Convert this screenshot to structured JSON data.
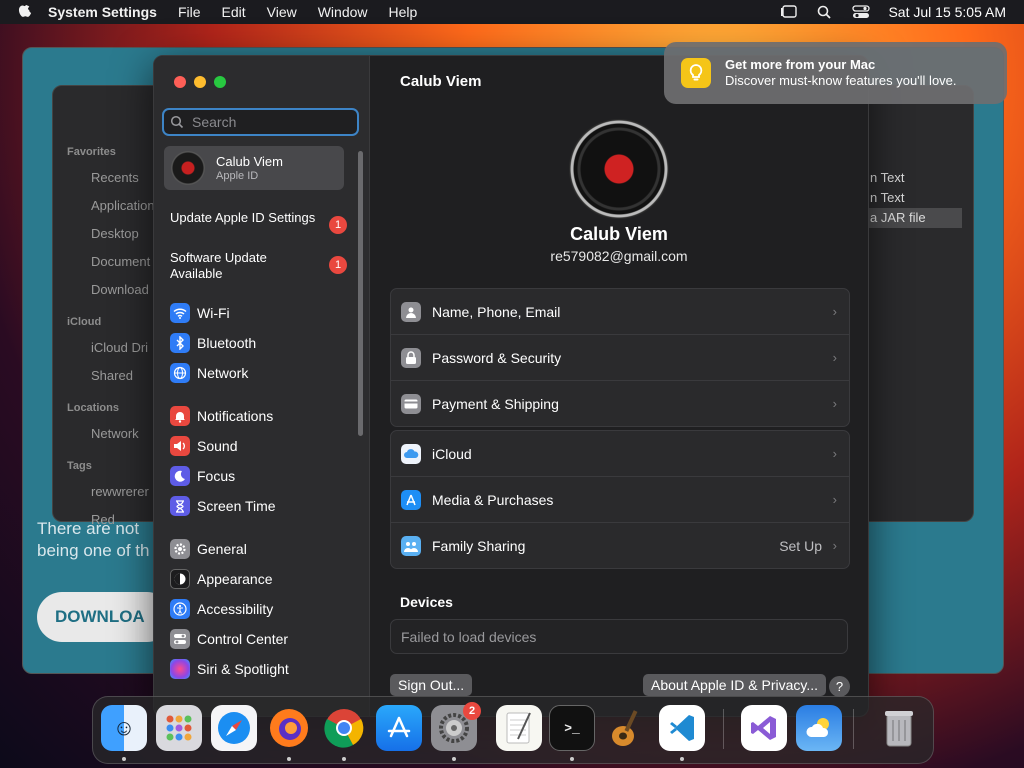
{
  "menubar": {
    "app": "System Settings",
    "menus": [
      "File",
      "Edit",
      "View",
      "Window",
      "Help"
    ],
    "clock": "Sat Jul 15  5:05 AM"
  },
  "background": {
    "finder_sidebar": [
      "Favorites",
      "Recents",
      "Application",
      "Desktop",
      "Document",
      "Download",
      "iCloud",
      "iCloud Dri",
      "Shared",
      "Locations",
      "Network",
      "Tags",
      "rewwrerer",
      "Red"
    ],
    "finder_rows": [
      "n Text",
      "n Text",
      "a JAR file"
    ],
    "web_text_1": "There are not",
    "web_text_2": "being one of th",
    "web_button": "DOWNLOA"
  },
  "settings": {
    "search_placeholder": "Search",
    "account": {
      "name": "Calub Viem",
      "sub": "Apple ID"
    },
    "notices": [
      {
        "label": "Update Apple ID Settings",
        "badge": "1"
      },
      {
        "label": "Software Update Available",
        "badge": "1"
      }
    ],
    "nav": [
      {
        "label": "Wi-Fi",
        "icon": "wifi-icon",
        "color": "#2f7cf6"
      },
      {
        "label": "Bluetooth",
        "icon": "bluetooth-icon",
        "color": "#2f7cf6"
      },
      {
        "label": "Network",
        "icon": "globe-icon",
        "color": "#2f7cf6"
      },
      {
        "label": "Notifications",
        "icon": "bell-icon",
        "color": "#e9483f"
      },
      {
        "label": "Sound",
        "icon": "speaker-icon",
        "color": "#e9483f"
      },
      {
        "label": "Focus",
        "icon": "moon-icon",
        "color": "#5e5ce6"
      },
      {
        "label": "Screen Time",
        "icon": "hourglass-icon",
        "color": "#5e5ce6"
      },
      {
        "label": "General",
        "icon": "gear-icon",
        "color": "#8e8e93"
      },
      {
        "label": "Appearance",
        "icon": "appearance-icon",
        "color": "#1c1c1e"
      },
      {
        "label": "Accessibility",
        "icon": "accessibility-icon",
        "color": "#2f7cf6"
      },
      {
        "label": "Control Center",
        "icon": "switches-icon",
        "color": "#8e8e93"
      },
      {
        "label": "Siri & Spotlight",
        "icon": "siri-icon",
        "color": "#b84fd8"
      }
    ],
    "main": {
      "title": "Calub Viem",
      "name": "Calub Viem",
      "email": "re579082@gmail.com",
      "group1": [
        {
          "label": "Name, Phone, Email",
          "icon": "person-icon"
        },
        {
          "label": "Password & Security",
          "icon": "lock-icon"
        },
        {
          "label": "Payment & Shipping",
          "icon": "creditcard-icon"
        }
      ],
      "group2": [
        {
          "label": "iCloud",
          "icon": "cloud-icon"
        },
        {
          "label": "Media & Purchases",
          "icon": "appstore-icon"
        },
        {
          "label": "Family Sharing",
          "icon": "family-icon",
          "value": "Set Up"
        }
      ],
      "devices_heading": "Devices",
      "devices_status": "Failed to load devices",
      "sign_out": "Sign Out...",
      "about": "About Apple ID & Privacy...",
      "help": "?"
    }
  },
  "notification": {
    "title": "Get more from your Mac",
    "body": "Discover must-know features you'll love."
  },
  "dock": {
    "apps": [
      "Finder",
      "Launchpad",
      "Safari",
      "Firefox",
      "Chrome",
      "App Store",
      "System Settings",
      "TextEdit",
      "Terminal",
      "GarageBand",
      "VS Code",
      "Visual Studio",
      "Weather",
      "Trash"
    ],
    "settings_badge": "2"
  }
}
